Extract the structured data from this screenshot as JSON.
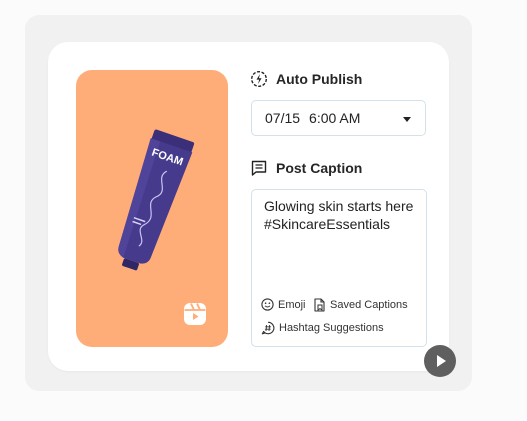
{
  "auto_publish": {
    "title": "Auto Publish",
    "icon": "clock-lightning-icon",
    "date": "07/15",
    "time": "6:00 AM"
  },
  "post_caption": {
    "title": "Post Caption",
    "icon": "caption-document-icon",
    "text_line_1": "Glowing skin starts here",
    "text_line_2": "#SkincareEssentials",
    "tools": {
      "emoji": "Emoji",
      "saved_captions": "Saved Captions",
      "hashtag_suggestions": "Hashtag Suggestions"
    }
  },
  "preview": {
    "product_brand": "FOAM",
    "background_color": "#ffad78",
    "tube_color": "#463a8c",
    "badge_icon": "reels-icon"
  },
  "player": {
    "icon": "play-icon"
  }
}
